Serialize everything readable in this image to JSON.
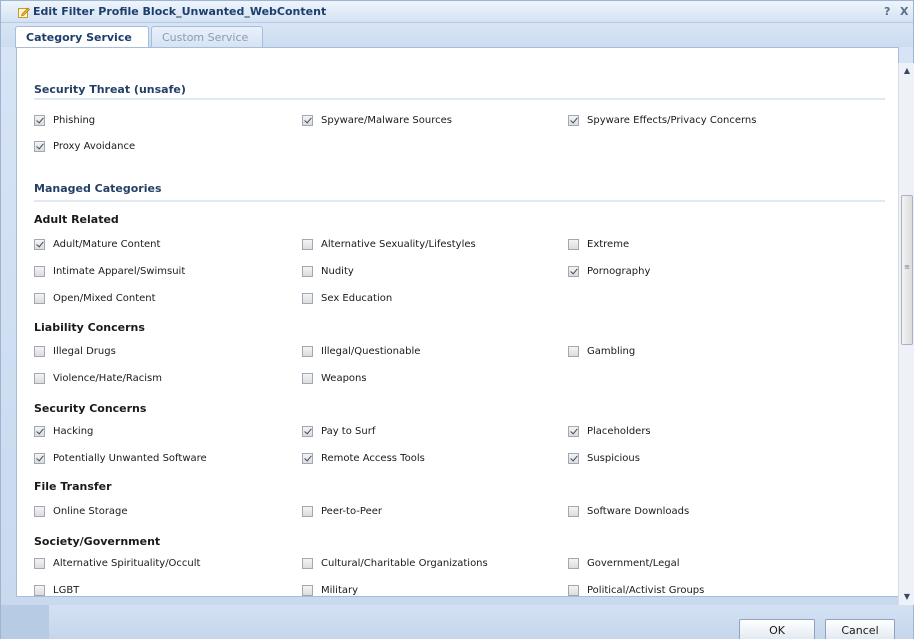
{
  "window": {
    "title": "Edit Filter Profile Block_Unwanted_WebContent",
    "help_label": "?",
    "close_label": "X"
  },
  "tabs": [
    {
      "label": "Category Service",
      "active": true
    },
    {
      "label": "Custom Service",
      "active": false
    }
  ],
  "security_threat": {
    "title": "Security Threat (unsafe)",
    "items": [
      {
        "label": "Phishing",
        "checked": true
      },
      {
        "label": "Spyware/Malware Sources",
        "checked": true
      },
      {
        "label": "Spyware Effects/Privacy Concerns",
        "checked": true
      },
      {
        "label": "Proxy Avoidance",
        "checked": true
      }
    ]
  },
  "managed": {
    "title": "Managed Categories",
    "groups": [
      {
        "title": "Adult Related",
        "items": [
          {
            "label": "Adult/Mature Content",
            "checked": true
          },
          {
            "label": "Alternative Sexuality/Lifestyles",
            "checked": false
          },
          {
            "label": "Extreme",
            "checked": false
          },
          {
            "label": "Intimate Apparel/Swimsuit",
            "checked": false
          },
          {
            "label": "Nudity",
            "checked": false
          },
          {
            "label": "Pornography",
            "checked": true
          },
          {
            "label": "Open/Mixed Content",
            "checked": false
          },
          {
            "label": "Sex Education",
            "checked": false
          }
        ]
      },
      {
        "title": "Liability Concerns",
        "items": [
          {
            "label": "Illegal Drugs",
            "checked": false
          },
          {
            "label": "Illegal/Questionable",
            "checked": false
          },
          {
            "label": "Gambling",
            "checked": false
          },
          {
            "label": "Violence/Hate/Racism",
            "checked": false
          },
          {
            "label": "Weapons",
            "checked": false
          }
        ]
      },
      {
        "title": "Security Concerns",
        "items": [
          {
            "label": "Hacking",
            "checked": true
          },
          {
            "label": "Pay to Surf",
            "checked": true
          },
          {
            "label": "Placeholders",
            "checked": true
          },
          {
            "label": "Potentially Unwanted Software",
            "checked": true
          },
          {
            "label": "Remote Access Tools",
            "checked": true
          },
          {
            "label": "Suspicious",
            "checked": true
          }
        ]
      },
      {
        "title": "File Transfer",
        "items": [
          {
            "label": "Online Storage",
            "checked": false
          },
          {
            "label": "Peer-to-Peer",
            "checked": false
          },
          {
            "label": "Software Downloads",
            "checked": false
          }
        ]
      },
      {
        "title": "Society/Government",
        "items": [
          {
            "label": "Alternative Spirituality/Occult",
            "checked": false
          },
          {
            "label": "Cultural/Charitable Organizations",
            "checked": false
          },
          {
            "label": "Government/Legal",
            "checked": false
          },
          {
            "label": "LGBT",
            "checked": false
          },
          {
            "label": "Military",
            "checked": false
          },
          {
            "label": "Political/Activist Groups",
            "checked": false
          }
        ]
      }
    ]
  },
  "buttons": {
    "ok": "OK",
    "cancel": "Cancel"
  },
  "icons": {
    "edit": "edit-pencil-icon",
    "scroll_up": "arrow-up-icon",
    "scroll_down": "arrow-down-icon"
  }
}
